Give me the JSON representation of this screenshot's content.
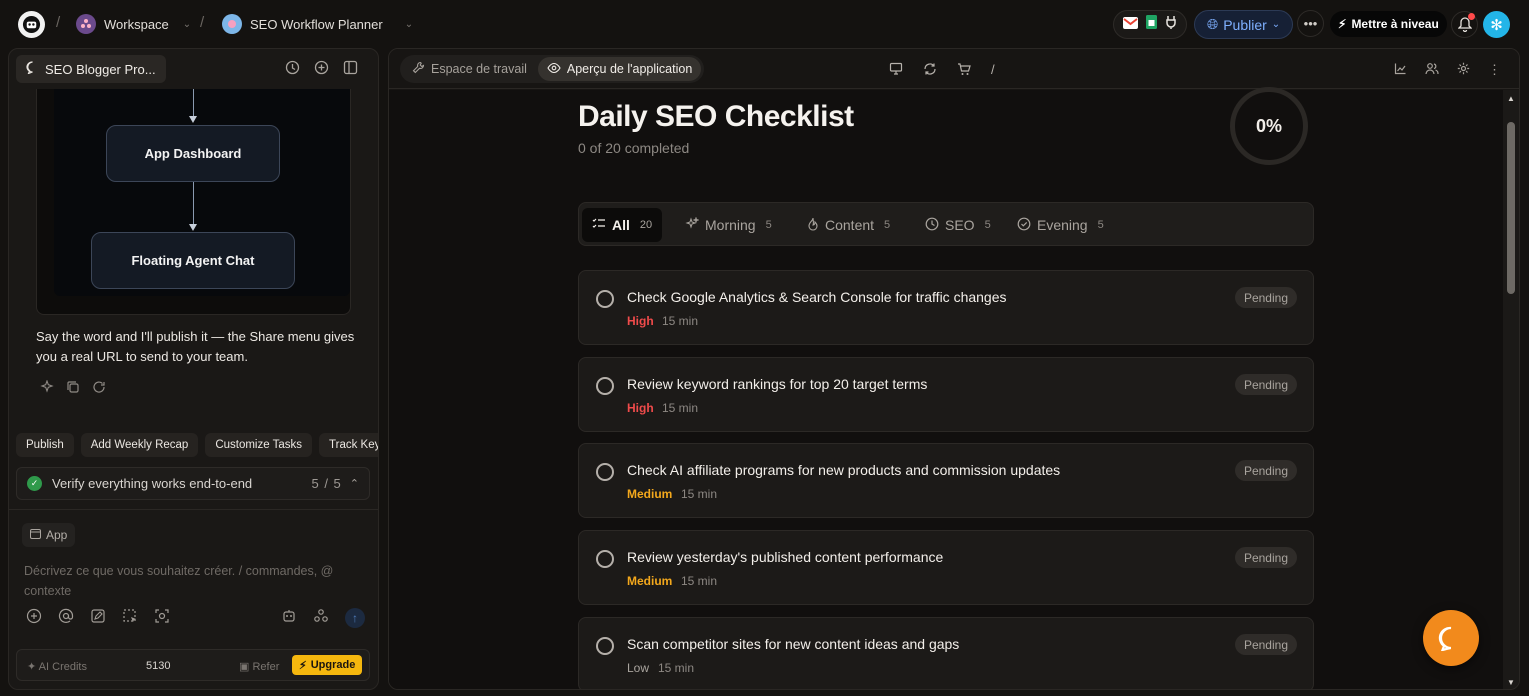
{
  "topbar": {
    "workspace": "Workspace",
    "project": "SEO Workflow Planner",
    "publish_label": "Publier",
    "upgrade_label": "Mettre à niveau",
    "icons": [
      "gmail-icon",
      "sheets-icon",
      "plug-icon"
    ]
  },
  "left": {
    "chat_tab": "SEO Blogger Pro...",
    "flow": {
      "node1": "App Dashboard",
      "node2": "Floating Agent Chat"
    },
    "message": "Say the word and I'll publish it — the Share menu gives you a real URL to send to your team.",
    "chips": [
      "Publish",
      "Add Weekly Recap",
      "Customize Tasks",
      "Track Keyw"
    ],
    "verify": {
      "label": "Verify everything works end-to-end",
      "count": "5 / 5"
    },
    "app_chip": "App",
    "prompt_placeholder": "Décrivez ce que vous souhaitez créer. / commandes, @ contexte",
    "credits": {
      "label": "AI Credits",
      "value": "5130",
      "refer": "Refer",
      "upgrade": "Upgrade"
    }
  },
  "right": {
    "tabs": [
      {
        "label": "Espace de travail",
        "active": false
      },
      {
        "label": "Aperçu de l'application",
        "active": true
      }
    ],
    "url_path": "/",
    "page": {
      "title": "Daily SEO Checklist",
      "subtitle": "0 of 20 completed",
      "progress_label": "0%",
      "progress_value": 0
    },
    "filters": [
      {
        "label": "All",
        "count": "20",
        "active": true,
        "icon": "list-check-icon"
      },
      {
        "label": "Morning",
        "count": "5",
        "active": false,
        "icon": "sparkle-icon"
      },
      {
        "label": "Content",
        "count": "5",
        "active": false,
        "icon": "flame-icon"
      },
      {
        "label": "SEO",
        "count": "5",
        "active": false,
        "icon": "clock-icon"
      },
      {
        "label": "Evening",
        "count": "5",
        "active": false,
        "icon": "check-circle-icon"
      }
    ],
    "tasks": [
      {
        "name": "Check Google Analytics & Search Console for traffic changes",
        "priority": "High",
        "duration": "15 min",
        "status": "Pending"
      },
      {
        "name": "Review keyword rankings for top 20 target terms",
        "priority": "High",
        "duration": "15 min",
        "status": "Pending"
      },
      {
        "name": "Check AI affiliate programs for new products and commission updates",
        "priority": "Medium",
        "duration": "15 min",
        "status": "Pending"
      },
      {
        "name": "Review yesterday's published content performance",
        "priority": "Medium",
        "duration": "15 min",
        "status": "Pending"
      },
      {
        "name": "Scan competitor sites for new content ideas and gaps",
        "priority": "Low",
        "duration": "15 min",
        "status": "Pending"
      }
    ],
    "priority_colors": {
      "High": "#f04b4b",
      "Medium": "#f3a81c",
      "Low": "#a9a49e"
    }
  },
  "colors": {
    "accent": "#f28a1c",
    "publish": "#7fb0ff",
    "upgrade": "#f5b70e"
  }
}
